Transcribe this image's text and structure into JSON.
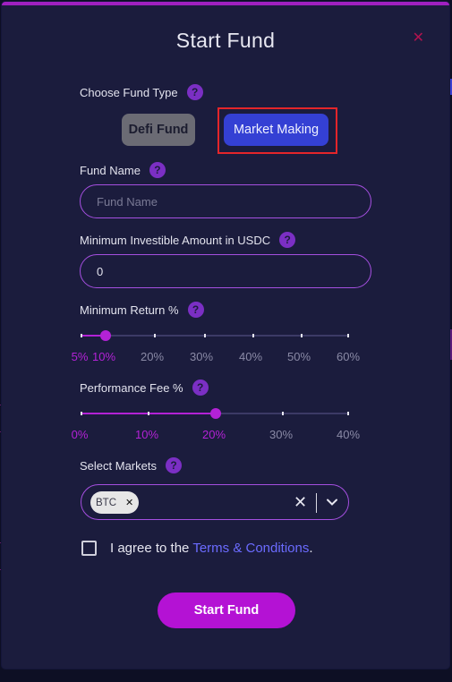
{
  "modal": {
    "title": "Start Fund",
    "close_icon": "close-icon",
    "help_icon": "question-mark-icon"
  },
  "fund_type": {
    "label": "Choose Fund Type",
    "options": [
      "Defi Fund",
      "Market Making"
    ],
    "selected": "Market Making"
  },
  "fund_name": {
    "label": "Fund Name",
    "value": "",
    "placeholder": "Fund Name"
  },
  "min_investible": {
    "label": "Minimum Investible Amount in USDC",
    "value": "0"
  },
  "min_return": {
    "label": "Minimum Return %",
    "value": 10,
    "ticks": [
      "5%",
      "10%",
      "20%",
      "30%",
      "40%",
      "50%",
      "60%"
    ]
  },
  "performance_fee": {
    "label": "Performance Fee %",
    "value": 20,
    "ticks": [
      "0%",
      "10%",
      "20%",
      "30%",
      "40%"
    ]
  },
  "markets": {
    "label": "Select Markets",
    "selected": [
      "BTC"
    ]
  },
  "agreement": {
    "prefix": "I agree to the",
    "link": "Terms & Conditions",
    "suffix": ".",
    "checked": false
  },
  "submit_label": "Start Fund",
  "colors": {
    "accent": "#b322d6",
    "primary_button": "#3440d4",
    "modal_bg": "#1b1c3d",
    "highlight": "#e4252a"
  }
}
